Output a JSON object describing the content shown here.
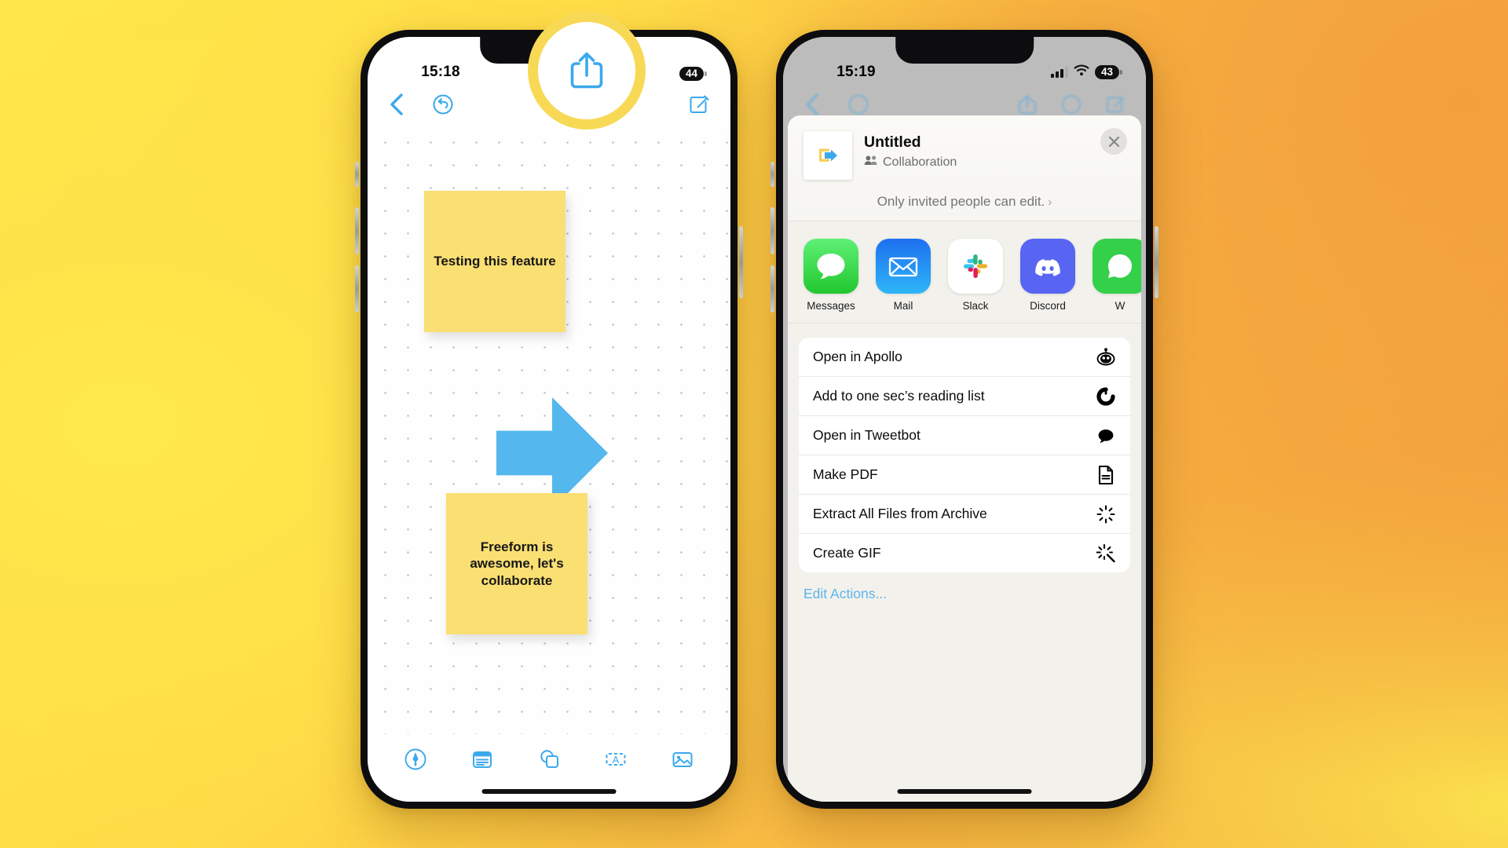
{
  "background": {
    "gradient_from": "#ffe84a",
    "gradient_to": "#f09a3a"
  },
  "left_phone": {
    "app_name": "Freeform",
    "status_bar": {
      "time": "15:18",
      "battery_percent": "44"
    },
    "toolbar": {
      "back_icon": "chevron-left-icon",
      "undo_icon": "undo-icon",
      "share_icon": "share-icon",
      "compose_icon": "compose-icon"
    },
    "canvas": {
      "notes": [
        {
          "text": "Testing this feature",
          "color": "#fadf72"
        },
        {
          "text": "Freeform is awesome, let's collaborate",
          "color": "#fadf72"
        }
      ],
      "shapes": [
        {
          "kind": "arrow-right",
          "color": "#54b8ee"
        }
      ]
    },
    "bottom_bar": {
      "items": [
        {
          "icon": "pen-tool-icon"
        },
        {
          "icon": "sticky-note-icon"
        },
        {
          "icon": "shapes-icon"
        },
        {
          "icon": "text-box-icon"
        },
        {
          "icon": "media-icon"
        }
      ]
    },
    "highlight": {
      "target": "share-icon",
      "ring_color": "#f8d955"
    }
  },
  "right_phone": {
    "status_bar": {
      "time": "15:19",
      "battery_percent": "43",
      "cellular_icon": "signal-bars-icon",
      "wifi_icon": "wifi-icon"
    },
    "share_sheet": {
      "document": {
        "title": "Untitled",
        "subtitle": "Collaboration",
        "subtitle_icon": "people-icon",
        "thumbnail_icon": "freeform-arrow-icon"
      },
      "close_label": "✕",
      "permission": {
        "text": "Only invited people can edit.",
        "chevron": "›"
      },
      "apps": [
        {
          "label": "Messages",
          "icon": "messages-icon",
          "color": "#3cd551"
        },
        {
          "label": "Mail",
          "icon": "mail-icon",
          "color": "#1d8cf0"
        },
        {
          "label": "Slack",
          "icon": "slack-icon",
          "color": "#ffffff"
        },
        {
          "label": "Discord",
          "icon": "discord-icon",
          "color": "#5561ea"
        },
        {
          "label": "W",
          "icon": "whatsapp-icon",
          "color": "#34d049"
        }
      ],
      "actions": [
        {
          "label": "Open in Apollo",
          "icon": "apollo-icon"
        },
        {
          "label": "Add to one sec’s reading list",
          "icon": "onesec-icon"
        },
        {
          "label": "Open in Tweetbot",
          "icon": "tweetbot-icon"
        },
        {
          "label": "Make PDF",
          "icon": "document-icon"
        },
        {
          "label": "Extract All Files from Archive",
          "icon": "sparkle-burst-icon"
        },
        {
          "label": "Create GIF",
          "icon": "magic-wand-icon"
        }
      ],
      "edit_actions_label": "Edit Actions..."
    }
  }
}
